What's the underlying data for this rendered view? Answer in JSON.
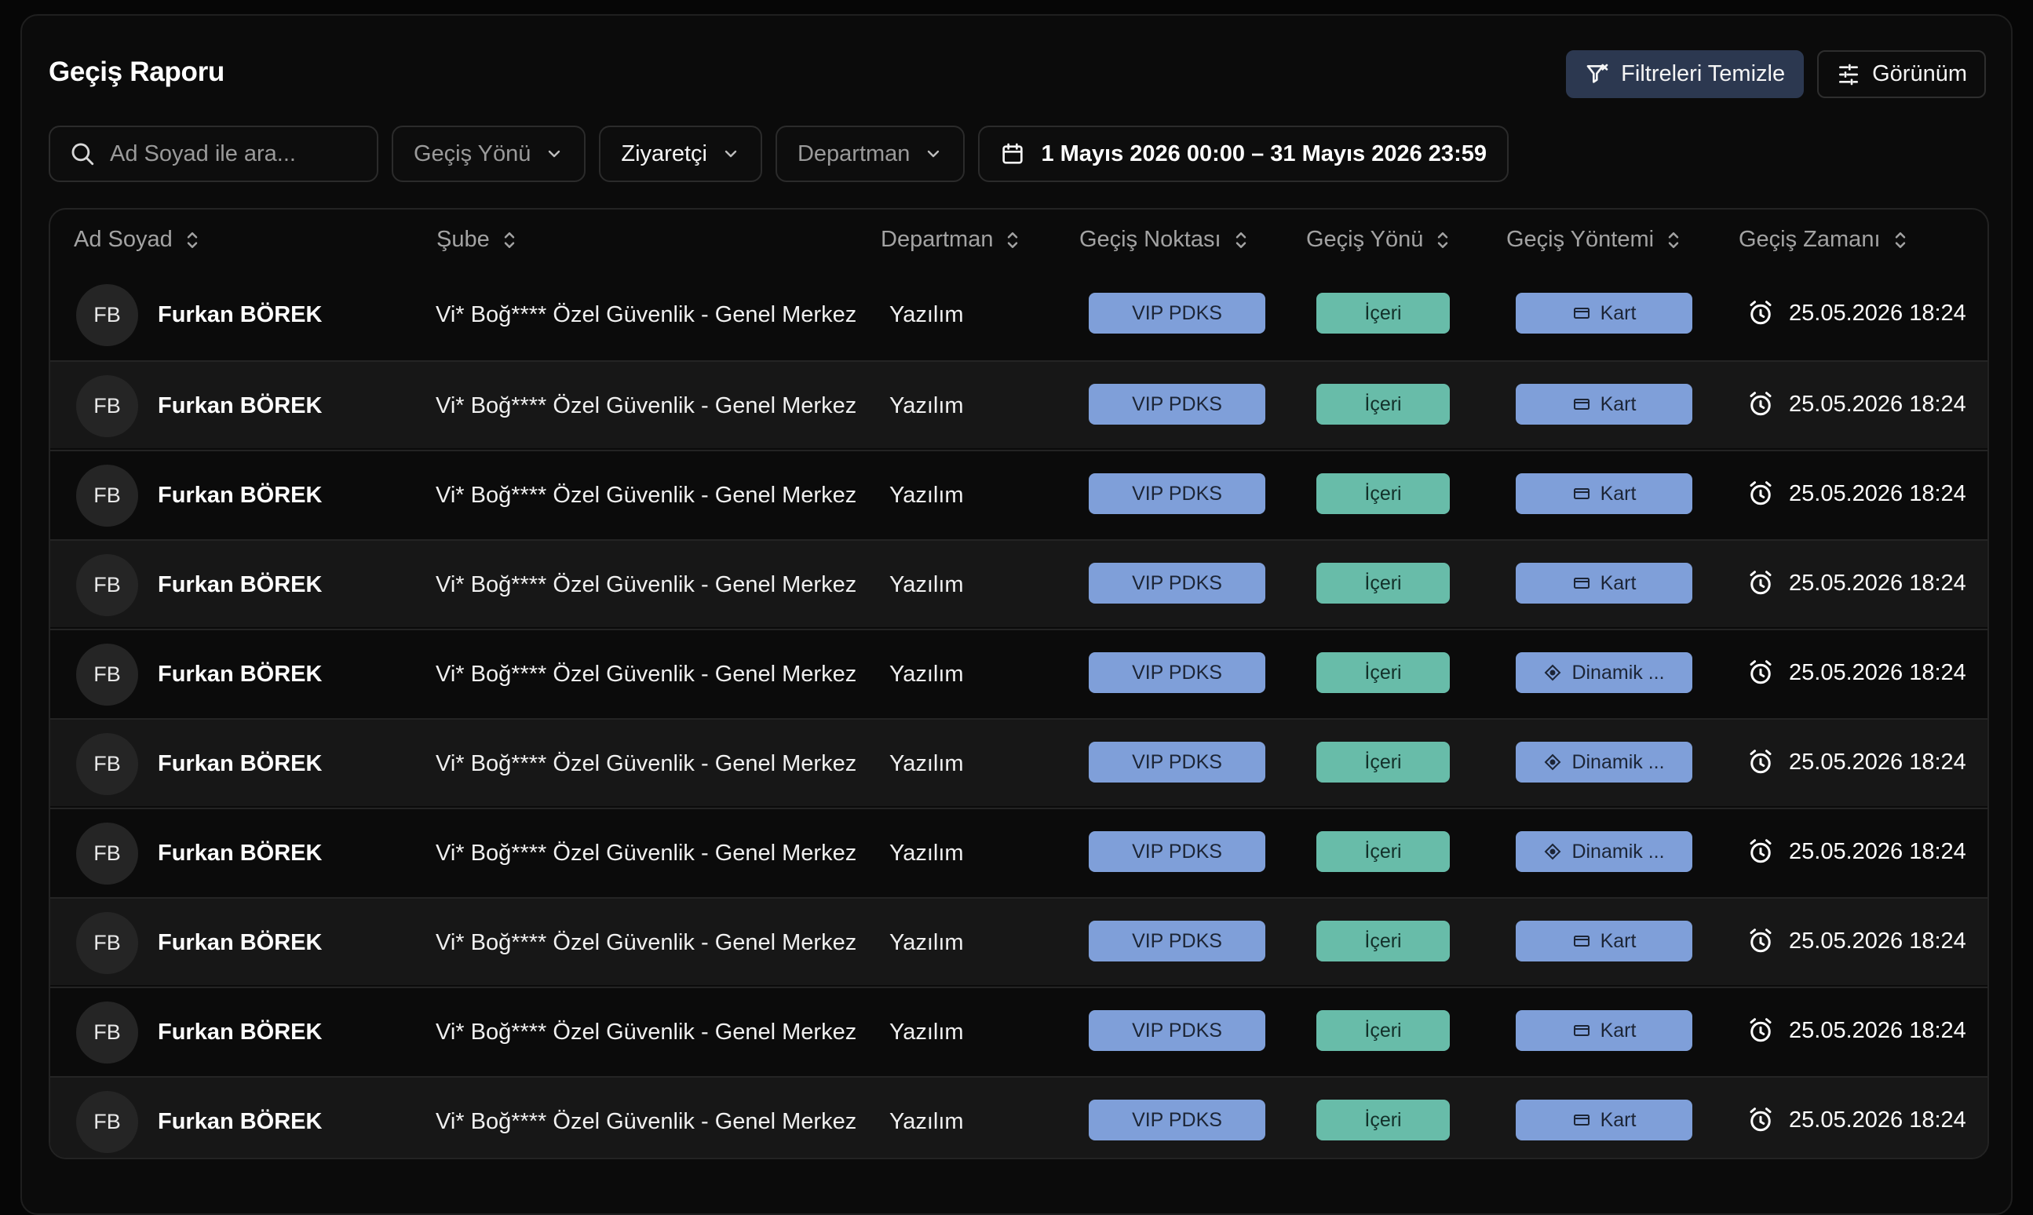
{
  "page": {
    "title": "Geçiş Raporu",
    "clear_filters_label": "Filtreleri Temizle",
    "view_label": "Görünüm"
  },
  "filters": {
    "search_placeholder": "Ad Soyad ile ara...",
    "direction_label": "Geçiş Yönü",
    "visitor_label": "Ziyaretçi",
    "department_label": "Departman",
    "date_range": "1 Mayıs 2026 00:00 – 31 Mayıs 2026 23:59"
  },
  "table": {
    "columns": [
      "Ad Soyad",
      "Şube",
      "Departman",
      "Geçiş Noktası",
      "Geçiş Yönü",
      "Geçiş Yöntemi",
      "Geçiş Zamanı"
    ],
    "rows": [
      {
        "initials": "FB",
        "name": "Furkan BÖREK",
        "branch": "Vi* Boğ**** Özel Güvenlik - Genel Merkez",
        "department": "Yazılım",
        "point": "VIP PDKS",
        "direction": "İçeri",
        "method": "Kart",
        "method_icon": "card-icon",
        "time": "25.05.2026 18:24"
      },
      {
        "initials": "FB",
        "name": "Furkan BÖREK",
        "branch": "Vi* Boğ**** Özel Güvenlik - Genel Merkez",
        "department": "Yazılım",
        "point": "VIP PDKS",
        "direction": "İçeri",
        "method": "Kart",
        "method_icon": "card-icon",
        "time": "25.05.2026 18:24"
      },
      {
        "initials": "FB",
        "name": "Furkan BÖREK",
        "branch": "Vi* Boğ**** Özel Güvenlik - Genel Merkez",
        "department": "Yazılım",
        "point": "VIP PDKS",
        "direction": "İçeri",
        "method": "Kart",
        "method_icon": "card-icon",
        "time": "25.05.2026 18:24"
      },
      {
        "initials": "FB",
        "name": "Furkan BÖREK",
        "branch": "Vi* Boğ**** Özel Güvenlik - Genel Merkez",
        "department": "Yazılım",
        "point": "VIP PDKS",
        "direction": "İçeri",
        "method": "Kart",
        "method_icon": "card-icon",
        "time": "25.05.2026 18:24"
      },
      {
        "initials": "FB",
        "name": "Furkan BÖREK",
        "branch": "Vi* Boğ**** Özel Güvenlik - Genel Merkez",
        "department": "Yazılım",
        "point": "VIP PDKS",
        "direction": "İçeri",
        "method": "Dinamik ...",
        "method_icon": "qr-dynamic-icon",
        "time": "25.05.2026 18:24"
      },
      {
        "initials": "FB",
        "name": "Furkan BÖREK",
        "branch": "Vi* Boğ**** Özel Güvenlik - Genel Merkez",
        "department": "Yazılım",
        "point": "VIP PDKS",
        "direction": "İçeri",
        "method": "Dinamik ...",
        "method_icon": "qr-dynamic-icon",
        "time": "25.05.2026 18:24"
      },
      {
        "initials": "FB",
        "name": "Furkan BÖREK",
        "branch": "Vi* Boğ**** Özel Güvenlik - Genel Merkez",
        "department": "Yazılım",
        "point": "VIP PDKS",
        "direction": "İçeri",
        "method": "Dinamik ...",
        "method_icon": "qr-dynamic-icon",
        "time": "25.05.2026 18:24"
      },
      {
        "initials": "FB",
        "name": "Furkan BÖREK",
        "branch": "Vi* Boğ**** Özel Güvenlik - Genel Merkez",
        "department": "Yazılım",
        "point": "VIP PDKS",
        "direction": "İçeri",
        "method": "Kart",
        "method_icon": "card-icon",
        "time": "25.05.2026 18:24"
      },
      {
        "initials": "FB",
        "name": "Furkan BÖREK",
        "branch": "Vi* Boğ**** Özel Güvenlik - Genel Merkez",
        "department": "Yazılım",
        "point": "VIP PDKS",
        "direction": "İçeri",
        "method": "Kart",
        "method_icon": "card-icon",
        "time": "25.05.2026 18:24"
      },
      {
        "initials": "FB",
        "name": "Furkan BÖREK",
        "branch": "Vi* Boğ**** Özel Güvenlik - Genel Merkez",
        "department": "Yazılım",
        "point": "VIP PDKS",
        "direction": "İçeri",
        "method": "Kart",
        "method_icon": "card-icon",
        "time": "25.05.2026 18:24"
      }
    ]
  },
  "colors": {
    "accent_blue": "#7f9fd9",
    "accent_green": "#68bca9",
    "clear_button_bg": "#2c3850"
  }
}
